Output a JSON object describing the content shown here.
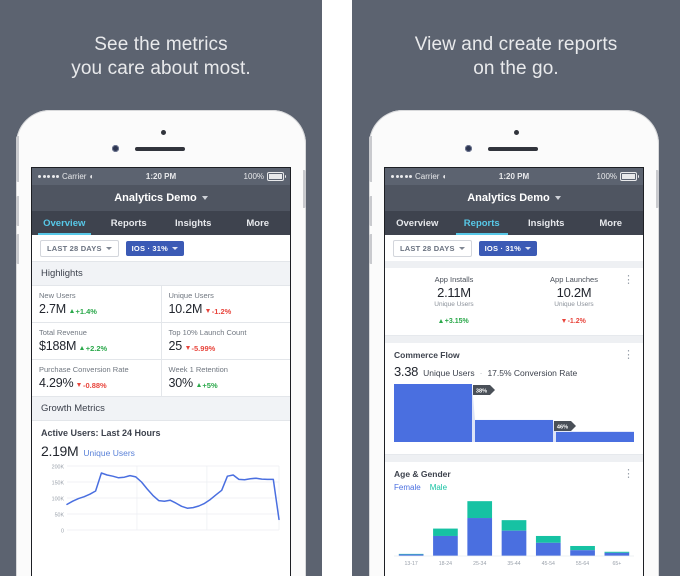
{
  "theme": {
    "background": "#5c6370",
    "accent_blue": "#3b5ab5",
    "tab_active": "#57c8e8",
    "up_green": "#2aa84a",
    "down_red": "#e8453c",
    "line_blue": "#4a6fe0",
    "teal": "#16c2a3"
  },
  "panels": [
    {
      "headline_line1": "See the metrics",
      "headline_line2": "you care about most.",
      "status": {
        "carrier": "Carrier",
        "wifi_icon": "wifi-icon",
        "time": "1:20 PM",
        "battery_pct": "100%",
        "battery_icon": "battery-icon"
      },
      "navbar": {
        "title": "Analytics Demo",
        "caret_icon": "chevron-down-icon"
      },
      "tabs": [
        {
          "label": "Overview",
          "active": true
        },
        {
          "label": "Reports",
          "active": false
        },
        {
          "label": "Insights",
          "active": false
        },
        {
          "label": "More",
          "active": false
        }
      ],
      "filters": [
        {
          "label": "LAST 28 DAYS",
          "style": "outline"
        },
        {
          "label": "IOS · 31%",
          "style": "filled"
        }
      ],
      "highlights_title": "Highlights",
      "metrics": [
        {
          "label": "New Users",
          "value": "2.7M",
          "delta": "+1.4%",
          "direction": "up"
        },
        {
          "label": "Unique Users",
          "value": "10.2M",
          "delta": "-1.2%",
          "direction": "down"
        },
        {
          "label": "Total Revenue",
          "value": "$188M",
          "delta": "+2.2%",
          "direction": "up"
        },
        {
          "label": "Top 10% Launch Count",
          "value": "25",
          "delta": "-5.99%",
          "direction": "down"
        },
        {
          "label": "Purchase Conversion Rate",
          "value": "4.29%",
          "delta": "-0.88%",
          "direction": "down"
        },
        {
          "label": "Week 1 Retention",
          "value": "30%",
          "delta": "+5%",
          "direction": "up"
        }
      ],
      "growth_title": "Growth Metrics",
      "growth_card": {
        "title": "Active Users: Last 24 Hours",
        "value": "2.19M",
        "sub": "Unique Users"
      }
    },
    {
      "headline_line1": "View and create reports",
      "headline_line2": "on the go.",
      "status": {
        "carrier": "Carrier",
        "wifi_icon": "wifi-icon",
        "time": "1:20 PM",
        "battery_pct": "100%",
        "battery_icon": "battery-icon"
      },
      "navbar": {
        "title": "Analytics Demo",
        "caret_icon": "chevron-down-icon"
      },
      "tabs": [
        {
          "label": "Overview",
          "active": false
        },
        {
          "label": "Reports",
          "active": true
        },
        {
          "label": "Insights",
          "active": false
        },
        {
          "label": "More",
          "active": false
        }
      ],
      "filters": [
        {
          "label": "LAST 28 DAYS",
          "style": "outline"
        },
        {
          "label": "IOS · 31%",
          "style": "filled"
        }
      ],
      "kpis": [
        {
          "label": "App Installs",
          "value": "2.11M",
          "sub": "Unique Users",
          "delta": "+3.15%",
          "direction": "up"
        },
        {
          "label": "App Launches",
          "value": "10.2M",
          "sub": "Unique Users",
          "delta": "-1.2%",
          "direction": "down"
        }
      ],
      "commerce": {
        "title": "Commerce Flow",
        "value": "3.38",
        "value_unit": "Unique Users",
        "separator": "·",
        "conversion": "17.5% Conversion Rate",
        "more_icon": "overflow-menu-icon"
      },
      "age_gender": {
        "title": "Age & Gender",
        "more_icon": "overflow-menu-icon",
        "legend": [
          "Female",
          "Male"
        ]
      }
    }
  ],
  "chart_data": [
    {
      "type": "line",
      "title": "Active Users: Last 24 Hours",
      "ylabel": "",
      "xlabel": "",
      "ylim": [
        0,
        200000
      ],
      "yticks": [
        "0",
        "50K",
        "100K",
        "150K",
        "200K"
      ],
      "series": [
        {
          "name": "Unique Users",
          "color": "#4a6fe0",
          "values": [
            80000,
            90000,
            98000,
            104000,
            112000,
            122000,
            178000,
            172000,
            168000,
            163000,
            165000,
            170000,
            166000,
            150000,
            128000,
            108000,
            92000,
            90000,
            93000,
            84000,
            74000,
            68000,
            70000,
            75000,
            83000,
            95000,
            110000,
            124000,
            168000,
            172000,
            158000,
            157000,
            160000,
            162000,
            159000,
            158000,
            158000,
            33000
          ]
        }
      ]
    },
    {
      "type": "bar",
      "subtype": "funnel",
      "title": "Commerce Flow",
      "stages": [
        {
          "value": 100,
          "label": ""
        },
        {
          "value": 38,
          "label": "38%"
        },
        {
          "value": 17.5,
          "label": "46%"
        }
      ],
      "step_labels": [
        "38%",
        "46%"
      ],
      "color": "#4a6fe0",
      "connector_color": "#dce3f7"
    },
    {
      "type": "bar",
      "subtype": "stacked",
      "title": "Age & Gender",
      "categories": [
        "13-17",
        "18-24",
        "25-34",
        "35-44",
        "45-54",
        "55-64",
        "65+"
      ],
      "series": [
        {
          "name": "Female",
          "color": "#4a6fe0",
          "values": [
            3,
            38,
            72,
            48,
            25,
            11,
            6
          ]
        },
        {
          "name": "Male",
          "color": "#16c2a3",
          "values": [
            1,
            14,
            32,
            20,
            13,
            8,
            2
          ]
        }
      ],
      "ylim": [
        0,
        110
      ],
      "legend_position": "top-left"
    }
  ]
}
